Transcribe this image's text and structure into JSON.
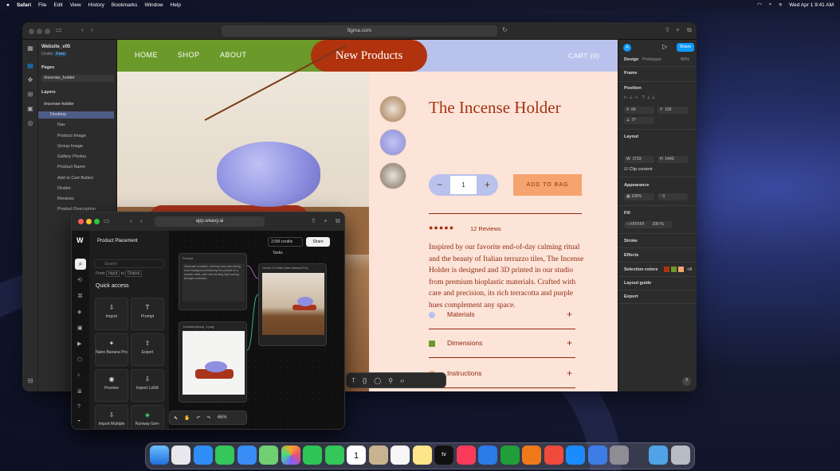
{
  "menubar": {
    "apple": "",
    "app": "Safari",
    "items": [
      "File",
      "Edit",
      "View",
      "History",
      "Bookmarks",
      "Window",
      "Help"
    ],
    "clock": "Wed Apr 1  9:41 AM"
  },
  "browser": {
    "url": "figma.com"
  },
  "figma_left": {
    "file_name": "Website_v05",
    "drafts": "Drafts",
    "plan": "Free",
    "pages_header": "Pages",
    "page": "/incense_holder",
    "layers_header": "Layers",
    "layers": [
      "/incense-holder",
      "Desktop",
      "Nav",
      "Product Image",
      "Group Image",
      "Gallery Photos",
      "Product Name",
      "Add to Cart Button",
      "Divider",
      "Reviews",
      "Product Description"
    ]
  },
  "site": {
    "nav": [
      "HOME",
      "SHOP",
      "ABOUT"
    ],
    "pill": "New Products",
    "cart": "CART (0)",
    "title": "The Incense Holder",
    "qty_minus": "−",
    "qty_value": "1",
    "qty_plus": "+",
    "add_to_bag": "ADD TO BAG",
    "stars": "●●●●●",
    "reviews": "12 Reviews",
    "description": "Inspired by our favorite end-of-day calming ritual and the beauty of Italian terrazzo tiles, The Incense Holder is designed and 3D printed in our studio from premium bioplastic materials. Crafted with care and precision, its rich terracotta and purple hues complement any space.",
    "accordion": [
      {
        "label": "Materials"
      },
      {
        "label": "Dimensions"
      },
      {
        "label": "Instructions"
      }
    ],
    "accordion_plus": "+"
  },
  "figma_right": {
    "avatar": "A",
    "share": "Share",
    "tab_design": "Design",
    "tab_prototype": "Prototype",
    "zoom": "80%",
    "frame": "Frame",
    "position": "Position",
    "x": "64",
    "y": "100",
    "rot": "0°",
    "layout": "Layout",
    "w": "1719",
    "h": "1443",
    "clip": "Clip content",
    "appearance": "Appearance",
    "opacity": "100%",
    "radius": "0",
    "fill": "Fill",
    "fill_hex": "FFFFFF",
    "fill_opacity": "100",
    "stroke": "Stroke",
    "effects": "Effects",
    "selection_colors": "Selection colors",
    "selection_more": "+8",
    "layout_guide": "Layout guide",
    "export": "Export",
    "help": "?"
  },
  "weavy": {
    "url": "app.weavy.ai",
    "project": "Product Placement",
    "search_placeholder": "Search",
    "from": "From",
    "input": "Input",
    "to": "to",
    "output": "Output",
    "quick_access": "Quick access",
    "tiles": [
      {
        "label": "Import",
        "glyph": "⇩"
      },
      {
        "label": "Prompt",
        "glyph": "T"
      },
      {
        "label": "Nano Banana Pro",
        "glyph": "✦"
      },
      {
        "label": "Export",
        "glyph": "⇧"
      },
      {
        "label": "Preview",
        "glyph": "◉"
      },
      {
        "label": "Import LoRA",
        "glyph": "⇩"
      },
      {
        "label": "Import Multiple",
        "glyph": "⇩"
      },
      {
        "label": "Runway Gen-",
        "glyph": "◈"
      }
    ],
    "credits": "3.5M credits",
    "share": "Share",
    "tasks": "Tasks",
    "node_prompt_title": "Prompt",
    "node_prompt_text": "Generate a modern, minimal, and calm dining room background featuring the product on a wooden table, with soft morning light coming through a window...",
    "node_image_title": "Gemini 2.5 Flash (Nano Banana Pro)",
    "node_upload_title": "Tutorial/Upload_1.png",
    "zoom": "46%"
  },
  "colors": {
    "green": "#6b9a2a",
    "terracotta": "#b0330e",
    "lavender": "#b9c2ec",
    "peach": "#fde4d8",
    "orange": "#f5a46f",
    "figma_blue": "#0d99ff"
  }
}
